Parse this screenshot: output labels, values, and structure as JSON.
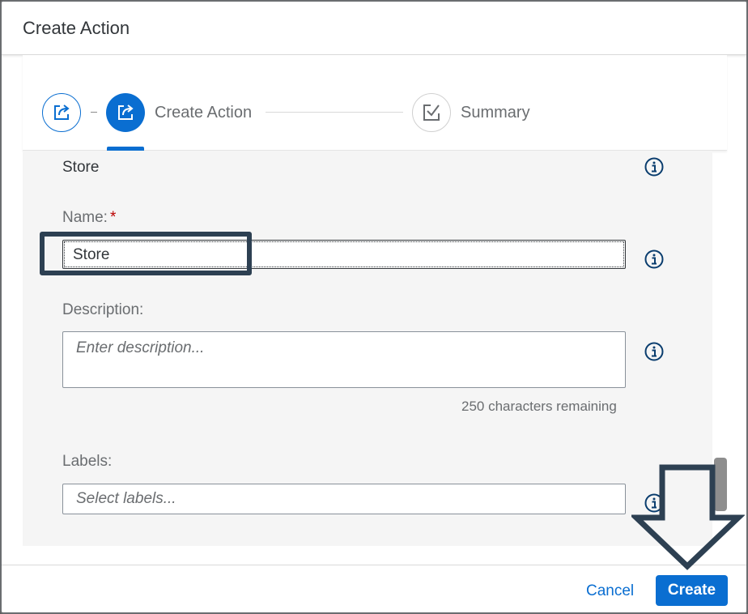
{
  "dialog": {
    "title": "Create Action"
  },
  "wizard": {
    "steps": [
      {
        "label": "",
        "icon": "share-icon",
        "state": "completed"
      },
      {
        "label": "Create Action",
        "icon": "share-icon",
        "state": "active"
      },
      {
        "label": "Summary",
        "icon": "checkbox-icon",
        "state": "pending"
      }
    ],
    "separator": "-"
  },
  "form": {
    "section_title": "Store",
    "name": {
      "label": "Name:",
      "required_marker": "*",
      "value": "Store"
    },
    "description": {
      "label": "Description:",
      "placeholder": "Enter description...",
      "value": "",
      "remaining": "250 characters remaining"
    },
    "labels": {
      "label": "Labels:",
      "placeholder": "Select labels...",
      "value": ""
    }
  },
  "footer": {
    "cancel_label": "Cancel",
    "create_label": "Create"
  },
  "colors": {
    "accent": "#0a6ed1",
    "required": "#bb0000",
    "annotation": "#2d4052"
  }
}
